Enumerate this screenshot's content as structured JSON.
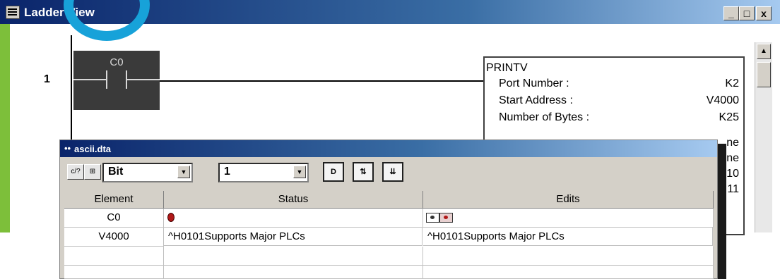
{
  "ladder_view": {
    "title": "Ladder View",
    "controls": {
      "minimize": "_",
      "maximize": "□",
      "close": "x"
    },
    "rung_number": "1",
    "contact": {
      "label": "C0"
    },
    "instruction": {
      "name": "PRINTV",
      "params": [
        {
          "label": "Port Number :",
          "value": "K2"
        },
        {
          "label": "Start Address :",
          "value": "V4000"
        },
        {
          "label": "Number of Bytes :",
          "value": "K25"
        }
      ],
      "partial_values": [
        "ne",
        "ne",
        "10",
        "11"
      ]
    }
  },
  "data_view": {
    "title": "ascii.dta",
    "toolbar": {
      "format_select": "Bit",
      "count_select": "1"
    },
    "table": {
      "headers": [
        "Element",
        "Status",
        "Edits"
      ],
      "rows": [
        {
          "element": "C0",
          "status": "",
          "edits": ""
        },
        {
          "element": "V4000",
          "status": "^H0101Supports Major PLCs",
          "edits": "^H0101Supports Major PLCs"
        },
        {
          "element": "",
          "status": "",
          "edits": ""
        },
        {
          "element": "",
          "status": "",
          "edits": ""
        }
      ]
    }
  },
  "colors": {
    "title_bar": "#0a246a",
    "accent_circle": "#17a2d9",
    "contact_fill": "#3a3a3a",
    "left_rail": "#7dbf3a",
    "status_on": "#b01818"
  },
  "icons": [
    "app-icon",
    "toggle-view-icon",
    "new-page-icon",
    "write-icon",
    "write-all-icon",
    "status-led-icon",
    "edit-toggle-icon"
  ]
}
